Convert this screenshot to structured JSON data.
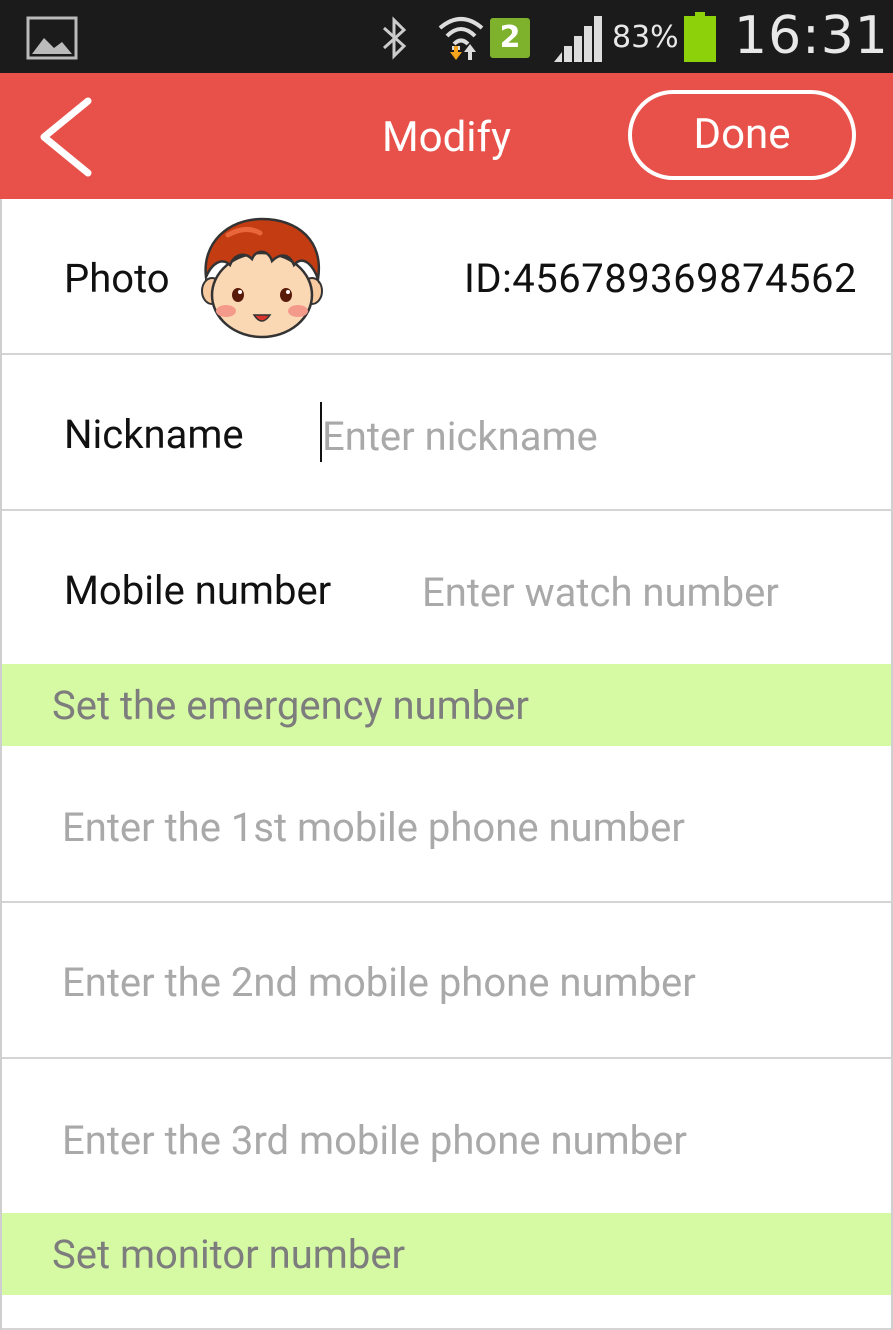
{
  "status_bar": {
    "sim_slot": "2",
    "battery_percent": "83%",
    "time": "16:31",
    "icons": [
      "gallery-icon",
      "bluetooth-icon",
      "wifi-icon",
      "signal-icon",
      "battery-icon"
    ],
    "battery_color": "#8cd10a"
  },
  "header": {
    "title": "Modify",
    "done_label": "Done",
    "accent_color": "#e8514a"
  },
  "profile": {
    "photo_label": "Photo",
    "device_id": "ID:456789369874562"
  },
  "nickname": {
    "label": "Nickname",
    "value": "",
    "placeholder": "Enter nickname"
  },
  "mobile": {
    "label": "Mobile number",
    "value": "",
    "placeholder": "Enter watch number"
  },
  "emergency": {
    "section_title": "Set the emergency number",
    "fields": [
      {
        "placeholder": "Enter the 1st mobile phone number",
        "value": ""
      },
      {
        "placeholder": "Enter the 2nd mobile phone number",
        "value": ""
      },
      {
        "placeholder": "Enter the 3rd mobile phone number",
        "value": ""
      }
    ]
  },
  "monitor": {
    "section_title": "Set monitor number"
  },
  "colors": {
    "section_bg": "#d6f9a4",
    "placeholder": "#a9a9a9"
  }
}
